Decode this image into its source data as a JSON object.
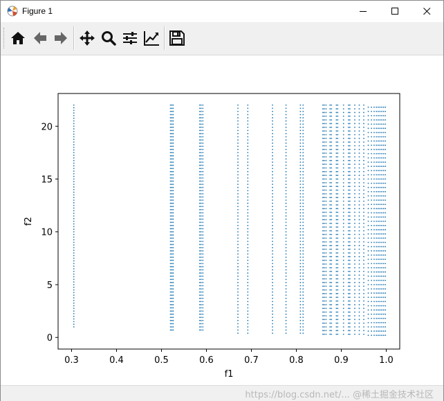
{
  "window": {
    "title": "Figure 1",
    "icons": {
      "app": "matplotlib-icon",
      "minimize": "minimize-icon",
      "maximize": "maximize-icon",
      "close": "close-icon"
    }
  },
  "toolbar": {
    "buttons": [
      {
        "name": "home-button",
        "icon": "home-icon"
      },
      {
        "name": "back-button",
        "icon": "arrow-left-icon"
      },
      {
        "name": "forward-button",
        "icon": "arrow-right-icon"
      },
      {
        "name": "pan-button",
        "icon": "move-icon"
      },
      {
        "name": "zoom-button",
        "icon": "magnifier-icon"
      },
      {
        "name": "configure-subplots-button",
        "icon": "sliders-icon"
      },
      {
        "name": "edit-axis-button",
        "icon": "line-chart-icon"
      },
      {
        "name": "save-button",
        "icon": "floppy-disk-icon"
      }
    ]
  },
  "status": {
    "watermark": "https://blog.csdn.net/... @稀土掘金技术社区"
  },
  "chart_data": {
    "type": "scatter",
    "title": "",
    "xlabel": "f1",
    "ylabel": "f2",
    "xlim": [
      0.27,
      1.03
    ],
    "ylim": [
      -1.1,
      23.1
    ],
    "xticks": [
      "0.3",
      "0.4",
      "0.5",
      "0.6",
      "0.7",
      "0.8",
      "0.9",
      "1.0"
    ],
    "yticks": [
      "0",
      "5",
      "10",
      "15",
      "20"
    ],
    "marker_color": "#1f77b4",
    "series": [
      {
        "columns": [
          {
            "x": 0.305,
            "y_min": 1.0,
            "y_max": 22.0,
            "dy": 0.25
          },
          {
            "x": 0.52,
            "y_min": 0.7,
            "y_max": 22.0,
            "dy": 0.3
          },
          {
            "x": 0.523,
            "y_min": 0.7,
            "y_max": 22.0,
            "dy": 0.3
          },
          {
            "x": 0.526,
            "y_min": 0.7,
            "y_max": 22.0,
            "dy": 0.3
          },
          {
            "x": 0.585,
            "y_min": 0.7,
            "y_max": 22.0,
            "dy": 0.3
          },
          {
            "x": 0.588,
            "y_min": 0.7,
            "y_max": 22.0,
            "dy": 0.3
          },
          {
            "x": 0.592,
            "y_min": 0.7,
            "y_max": 22.0,
            "dy": 0.3
          },
          {
            "x": 0.67,
            "y_min": 0.4,
            "y_max": 22.0,
            "dy": 0.3
          },
          {
            "x": 0.692,
            "y_min": 0.4,
            "y_max": 22.0,
            "dy": 0.3
          },
          {
            "x": 0.747,
            "y_min": 0.4,
            "y_max": 22.0,
            "dy": 0.3
          },
          {
            "x": 0.777,
            "y_min": 0.4,
            "y_max": 22.0,
            "dy": 0.3
          },
          {
            "x": 0.809,
            "y_min": 0.4,
            "y_max": 22.0,
            "dy": 0.3
          },
          {
            "x": 0.815,
            "y_min": 0.4,
            "y_max": 22.0,
            "dy": 0.3
          },
          {
            "x": 0.859,
            "y_min": 0.3,
            "y_max": 22.0,
            "dy": 0.35
          },
          {
            "x": 0.862,
            "y_min": 0.3,
            "y_max": 22.0,
            "dy": 0.35
          },
          {
            "x": 0.866,
            "y_min": 0.3,
            "y_max": 22.0,
            "dy": 0.35
          },
          {
            "x": 0.875,
            "y_min": 0.3,
            "y_max": 22.0,
            "dy": 0.35
          },
          {
            "x": 0.878,
            "y_min": 0.3,
            "y_max": 22.0,
            "dy": 0.35
          },
          {
            "x": 0.889,
            "y_min": 0.3,
            "y_max": 22.0,
            "dy": 0.35
          },
          {
            "x": 0.892,
            "y_min": 0.3,
            "y_max": 22.0,
            "dy": 0.35
          },
          {
            "x": 0.905,
            "y_min": 0.3,
            "y_max": 22.0,
            "dy": 0.35
          },
          {
            "x": 0.916,
            "y_min": 0.3,
            "y_max": 22.0,
            "dy": 0.35
          },
          {
            "x": 0.919,
            "y_min": 0.3,
            "y_max": 22.0,
            "dy": 0.35
          },
          {
            "x": 0.93,
            "y_min": 0.3,
            "y_max": 22.0,
            "dy": 0.35
          },
          {
            "x": 0.94,
            "y_min": 0.3,
            "y_max": 22.0,
            "dy": 0.35
          },
          {
            "x": 0.95,
            "y_min": 0.3,
            "y_max": 22.0,
            "dy": 0.35
          },
          {
            "x": 0.96,
            "y_min": 0.2,
            "y_max": 22.0,
            "dy": 0.4
          },
          {
            "x": 0.967,
            "y_min": 0.2,
            "y_max": 22.0,
            "dy": 0.4
          },
          {
            "x": 0.973,
            "y_min": 0.2,
            "y_max": 22.0,
            "dy": 0.4
          },
          {
            "x": 0.978,
            "y_min": 0.2,
            "y_max": 22.0,
            "dy": 0.4
          },
          {
            "x": 0.982,
            "y_min": 0.2,
            "y_max": 22.0,
            "dy": 0.4
          },
          {
            "x": 0.986,
            "y_min": 0.2,
            "y_max": 22.0,
            "dy": 0.4
          },
          {
            "x": 0.99,
            "y_min": 0.2,
            "y_max": 22.0,
            "dy": 0.4
          },
          {
            "x": 0.994,
            "y_min": 0.2,
            "y_max": 22.0,
            "dy": 0.4
          },
          {
            "x": 0.998,
            "y_min": 0.2,
            "y_max": 22.0,
            "dy": 0.4
          }
        ]
      }
    ]
  }
}
